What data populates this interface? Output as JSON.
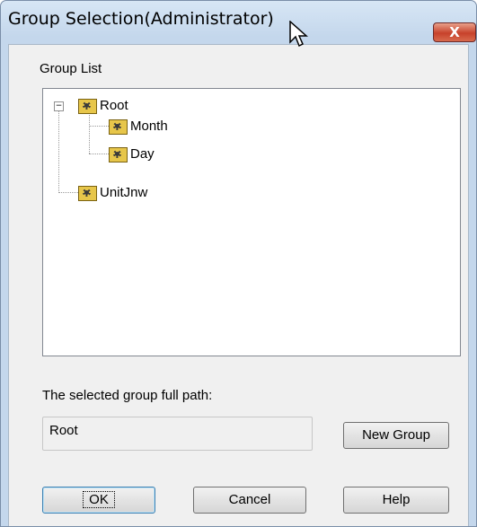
{
  "window": {
    "title": "Group Selection(Administrator)",
    "close_label": "X"
  },
  "group_list": {
    "label": "Group List",
    "tree": [
      {
        "label": "Root",
        "expander": "−"
      },
      {
        "label": "Month"
      },
      {
        "label": "Day"
      },
      {
        "label": "UnitJnw"
      }
    ]
  },
  "path": {
    "label": "The selected group full path:",
    "value": "Root"
  },
  "buttons": {
    "new_group": "New Group",
    "ok": "OK",
    "cancel": "Cancel",
    "help": "Help"
  },
  "colors": {
    "titlebar": "#c4d7ec",
    "close": "#c7422b",
    "folder": "#e7c64a"
  }
}
